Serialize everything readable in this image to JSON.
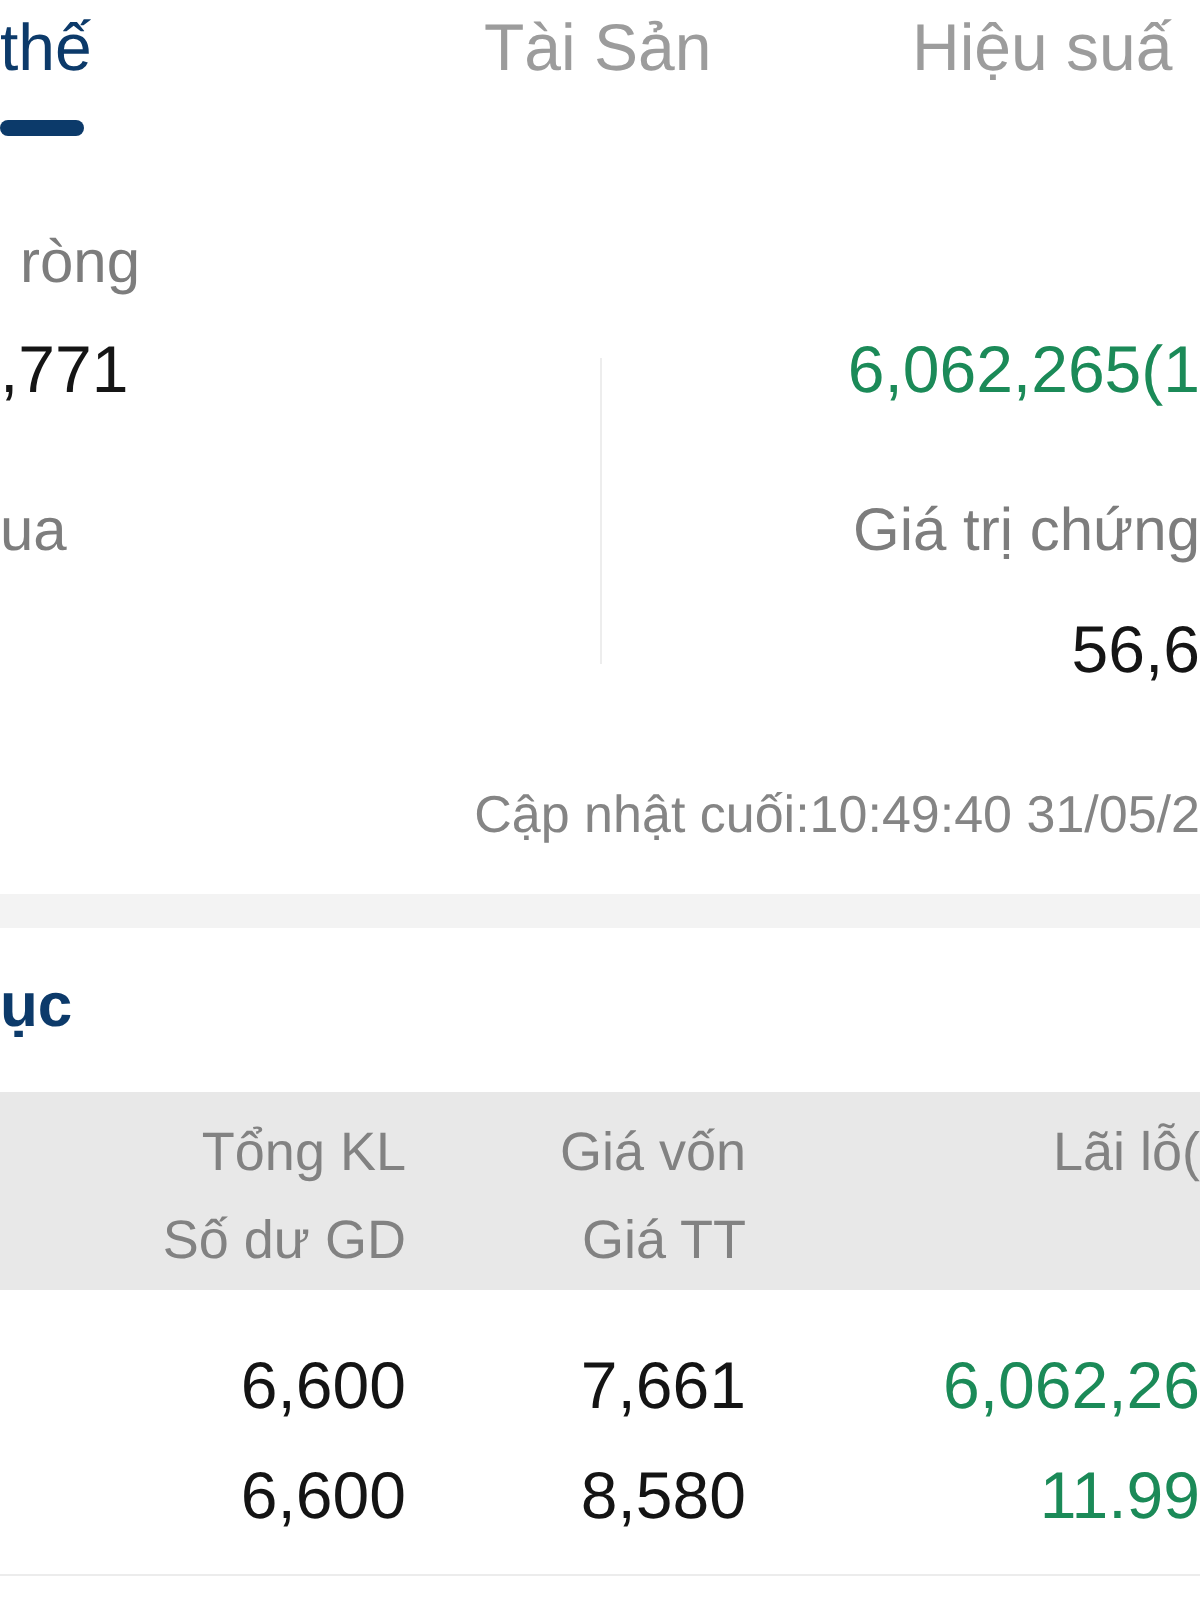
{
  "tabs": [
    {
      "label": "thế",
      "selected": true
    },
    {
      "label": "Tài Sản",
      "selected": false
    },
    {
      "label": "Hiệu suấ",
      "selected": false
    }
  ],
  "summary": {
    "rows": [
      {
        "left": {
          "kind": "label",
          "text": "ròng"
        }
      },
      {
        "left": {
          "kind": "value",
          "text": ",771"
        },
        "right": {
          "kind": "gain",
          "text": "6,062,265(1"
        }
      },
      {
        "left": {
          "kind": "label",
          "text": "ua"
        },
        "right": {
          "kind": "label",
          "text": "Giá trị chứng"
        }
      },
      {
        "right": {
          "kind": "value",
          "text": "56,6"
        }
      }
    ],
    "updated": "Cập nhật cuối:10:49:40 31/05/2"
  },
  "section": {
    "title": "ục"
  },
  "table": {
    "columns": [
      {
        "header": [
          "Tổng KL",
          "Số dư GD"
        ]
      },
      {
        "header": [
          "Giá vốn",
          "Giá TT"
        ]
      },
      {
        "header": [
          "Lãi lỗ("
        ]
      }
    ],
    "rows": [
      {
        "cells": [
          {
            "kind": "plain",
            "lines": [
              "6,600",
              "6,600"
            ]
          },
          {
            "kind": "plain",
            "lines": [
              "7,661",
              "8,580"
            ]
          },
          {
            "kind": "gain",
            "lines": [
              "6,062,26",
              "11.99"
            ]
          }
        ]
      }
    ]
  }
}
